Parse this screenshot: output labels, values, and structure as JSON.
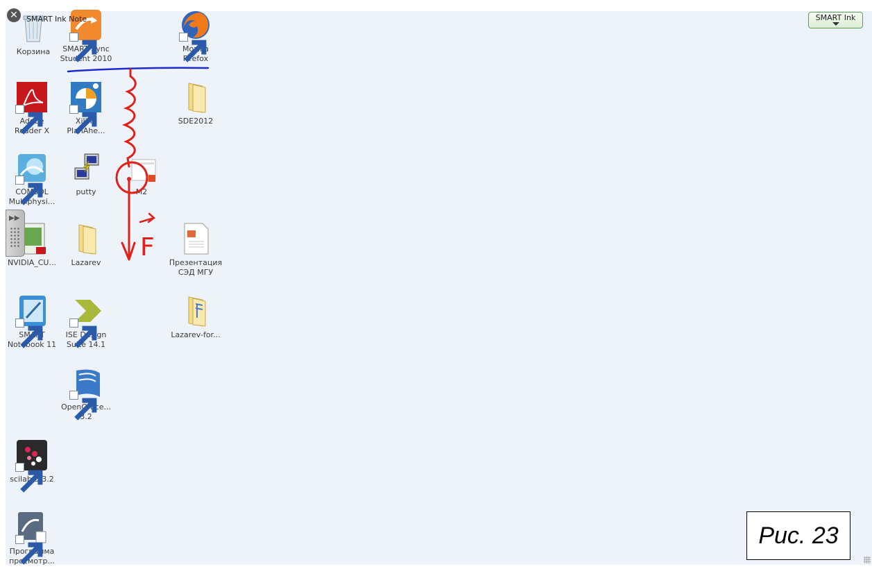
{
  "overlay": {
    "close_symbol": "✕",
    "note_title": "SMART Ink Note",
    "toolbar_button": "SMART Ink"
  },
  "icons": [
    {
      "label": "Корзина",
      "icon": "recycle-bin-icon"
    },
    {
      "label": "SMART Sync\nStudent 2010",
      "icon": "smart-sync-icon"
    },
    {
      "label": "Mozilla\nFirefox",
      "icon": "firefox-icon"
    },
    {
      "label": "Adobe\nReader X",
      "icon": "adobe-reader-icon"
    },
    {
      "label": "Xilinx\nPlanAhe...",
      "icon": "xilinx-planahead-icon"
    },
    {
      "label": "SDE2012",
      "icon": "folder-icon"
    },
    {
      "label": "COMSOL\nMultiphysi...",
      "icon": "comsol-icon"
    },
    {
      "label": "putty",
      "icon": "putty-icon"
    },
    {
      "label": "M2",
      "icon": "presentation-file-icon"
    },
    {
      "label": "NVIDIA_CU...",
      "icon": "pdf-file-icon"
    },
    {
      "label": "Lazarev",
      "icon": "folder-icon"
    },
    {
      "label": "Презентация\nСЭД МГУ",
      "icon": "presentation-file-icon"
    },
    {
      "label": "SMART\nNotebook 11",
      "icon": "smart-notebook-icon"
    },
    {
      "label": "ISE Design\nSuite 14.1",
      "icon": "ise-design-suite-icon"
    },
    {
      "label": "Lazarev-for...",
      "icon": "folder-icon"
    },
    {
      "label": "OpenOffice...\n3.2",
      "icon": "openoffice-icon"
    },
    {
      "label": "scilab-5.3.2",
      "icon": "scilab-icon"
    },
    {
      "label": "Программа\nпросмотр...",
      "icon": "xps-viewer-icon"
    }
  ],
  "annotation": {
    "force_label": "F",
    "ink_color": "#e0201a",
    "baseline_color": "#1a2ad0"
  },
  "caption": "Рис. 23"
}
